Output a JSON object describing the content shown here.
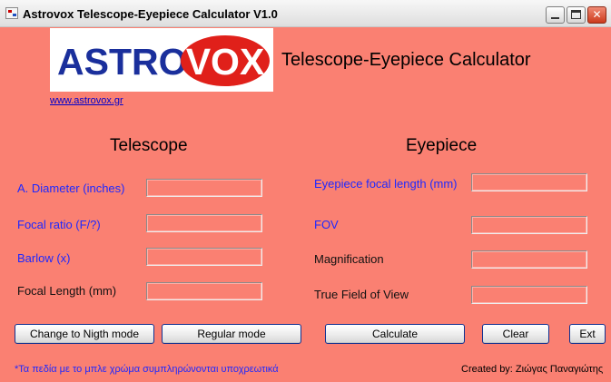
{
  "window": {
    "title": "Astrovox Telescope-Eyepiece Calculator V1.0",
    "controls": {
      "minimize": "",
      "maximize": "",
      "close": "✕"
    }
  },
  "header": {
    "logo_astro": "ASTRO",
    "logo_vox": "VOX",
    "app_title": "Telescope-Eyepiece Calculator",
    "website_link": "www.astrovox.gr"
  },
  "telescope": {
    "heading": "Telescope",
    "fields": [
      {
        "label": "A. Diameter (inches)",
        "value": "",
        "required": true
      },
      {
        "label": "Focal ratio (F/?)",
        "value": "",
        "required": true
      },
      {
        "label": "Barlow (x)",
        "value": "",
        "required": true
      },
      {
        "label": "Focal Length (mm)",
        "value": "",
        "required": false
      }
    ]
  },
  "eyepiece": {
    "heading": "Eyepiece",
    "fields": [
      {
        "label": "Eyepiece focal length (mm)",
        "value": "",
        "required": true
      },
      {
        "label": "FOV",
        "value": "",
        "required": true
      },
      {
        "label": "Magnification",
        "value": "",
        "required": false
      },
      {
        "label": "True Field of View",
        "value": "",
        "required": false
      }
    ]
  },
  "buttons": {
    "night_mode": "Change to Nigth mode",
    "regular_mode": "Regular mode",
    "calculate": "Calculate",
    "clear": "Clear",
    "exit": "Ext"
  },
  "footer": {
    "required_note": "*Τα πεδία με το μπλε χρώμα συμπληρώνονται υποχρεωτικά",
    "credit": "Created by: Ζιώγας Παναγιώτης"
  },
  "colors": {
    "background": "#fa8072",
    "required_label": "#1e28ff",
    "logo_blue": "#1a2f9c",
    "logo_red": "#e0201a"
  }
}
